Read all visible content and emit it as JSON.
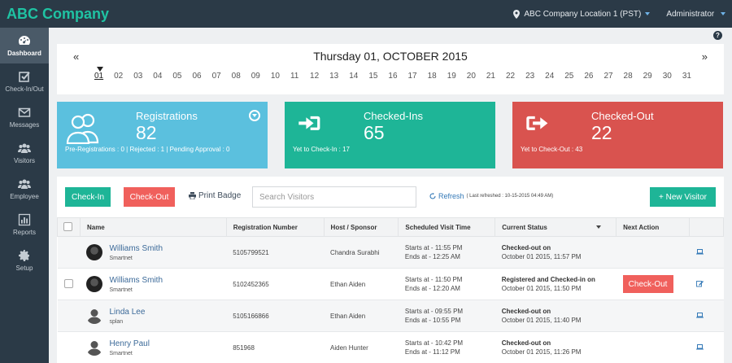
{
  "app": {
    "brand": "ABC Company"
  },
  "topbar": {
    "location": "ABC Company Location 1 (PST)",
    "user": "Administrator"
  },
  "sidebar": {
    "items": [
      {
        "label": "Dashboard",
        "icon": "dashboard-icon",
        "active": true
      },
      {
        "label": "Check-In/Out",
        "icon": "checkbox-icon"
      },
      {
        "label": "Messages",
        "icon": "envelope-icon"
      },
      {
        "label": "Visitors",
        "icon": "users-icon"
      },
      {
        "label": "Employee",
        "icon": "employees-icon"
      },
      {
        "label": "Reports",
        "icon": "bar-chart-icon"
      },
      {
        "label": "Setup",
        "icon": "gear-icon"
      }
    ]
  },
  "help": "?",
  "datebar": {
    "prev": "«",
    "next": "»",
    "title": "Thursday 01, OCTOBER 2015",
    "days": [
      "01",
      "02",
      "03",
      "04",
      "05",
      "06",
      "07",
      "08",
      "09",
      "10",
      "11",
      "12",
      "13",
      "14",
      "15",
      "16",
      "17",
      "18",
      "19",
      "20",
      "21",
      "22",
      "23",
      "24",
      "25",
      "26",
      "27",
      "28",
      "29",
      "30",
      "31"
    ],
    "selected": "01"
  },
  "cards": {
    "registrations": {
      "label": "Registrations",
      "value": "82",
      "sub": "Pre-Registrations : 0 | Rejected : 1 | Pending Approval : 0",
      "color": "#5bc0de"
    },
    "checkedins": {
      "label": "Checked-Ins",
      "value": "65",
      "sub": "Yet to Check-In : 17",
      "color": "#1eb597"
    },
    "checkedout": {
      "label": "Checked-Out",
      "value": "22",
      "sub": "Yet to Check-Out : 43",
      "color": "#d9534f"
    }
  },
  "toolbar": {
    "checkin": "Check-In",
    "checkout": "Check-Out",
    "print": "Print Badge",
    "search_placeholder": "Search Visitors",
    "refresh": "Refresh",
    "last_refreshed": "( Last refreshed : 10-15-2015 04:49 AM)",
    "new_visitor": "+ New Visitor"
  },
  "table": {
    "headers": {
      "name": "Name",
      "reg": "Registration Number",
      "host": "Host / Sponsor",
      "visit": "Scheduled Visit Time",
      "status": "Current Status",
      "next": "Next Action"
    },
    "rows": [
      {
        "name": "Williams Smith",
        "company": "Smartnet",
        "reg": "5105799521",
        "host": "Chandra Surabhi",
        "start": "Starts at - 11:55 PM",
        "end": "Ends at - 12:25 AM",
        "status": "Checked-out on",
        "status_time": "October 01 2015, 11:57 PM",
        "action": ""
      },
      {
        "name": "Williams Smith",
        "company": "Smartnet",
        "reg": "5102452365",
        "host": "Ethan Aiden",
        "start": "Starts at - 11:50 PM",
        "end": "Ends at - 12:20 AM",
        "status": "Registered and Checked-in on",
        "status_time": "October 01 2015, 11:50 PM",
        "action": "Check-Out"
      },
      {
        "name": "Linda Lee",
        "company": "splan",
        "reg": "5105166866",
        "host": "Ethan Aiden",
        "start": "Starts at - 09:55 PM",
        "end": "Ends at - 10:55 PM",
        "status": "Checked-out on",
        "status_time": "October 01 2015, 11:40 PM",
        "action": ""
      },
      {
        "name": "Henry Paul",
        "company": "Smartnet",
        "reg": "851968",
        "host": "Aiden Hunter",
        "start": "Starts at - 10:42 PM",
        "end": "Ends at - 11:12 PM",
        "status": "Checked-out on",
        "status_time": "October 01 2015, 11:26 PM",
        "action": ""
      }
    ]
  }
}
